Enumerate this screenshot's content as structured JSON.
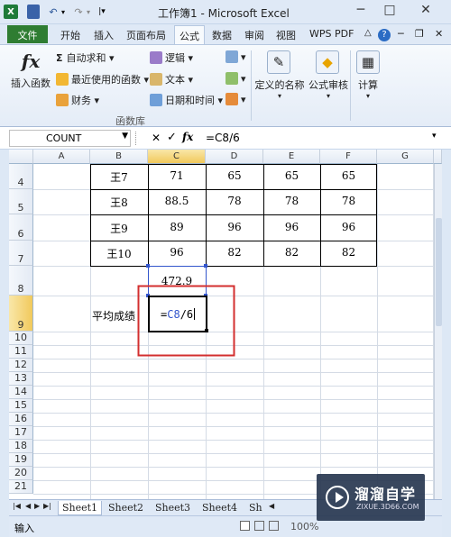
{
  "window": {
    "title": "工作簿1 - Microsoft Excel",
    "minimize_label": "─",
    "maximize_label": "□",
    "close_label": "✕"
  },
  "ribbon_tabs": [
    "文件",
    "开始",
    "插入",
    "页面布局",
    "公式",
    "数据",
    "审阅",
    "视图",
    "WPS PDF"
  ],
  "ribbon": {
    "insert_function": "插入函数",
    "autosum": "自动求和",
    "recent": "最近使用的函数",
    "finance": "财务",
    "logic": "逻辑",
    "text": "文本",
    "datetime": "日期和时间",
    "defined_names": "定义的名称",
    "audit": "公式审核",
    "calc": "计算",
    "group_label": "函数库",
    "fx_symbol": "fx",
    "sigma_symbol": "Σ"
  },
  "formula_bar": {
    "name_box": "COUNT",
    "cancel": "✕",
    "enter": "✓",
    "fx": "fx",
    "formula": "=C8/6"
  },
  "columns": [
    "A",
    "B",
    "C",
    "D",
    "E",
    "F",
    "G"
  ],
  "rows": [
    "4",
    "5",
    "6",
    "7",
    "8",
    "9",
    "10",
    "11",
    "12",
    "13",
    "14",
    "15",
    "16",
    "17",
    "18",
    "19",
    "20",
    "21"
  ],
  "table": [
    [
      "王7",
      "71",
      "65",
      "65",
      "65"
    ],
    [
      "王8",
      "88.5",
      "78",
      "78",
      "78"
    ],
    [
      "王9",
      "89",
      "96",
      "96",
      "96"
    ],
    [
      "王10",
      "96",
      "82",
      "82",
      "82"
    ]
  ],
  "c8_value": "472.9",
  "b9_label": "平均成绩",
  "c9_formula_prefix": "=",
  "c9_formula_ref": "C8",
  "c9_formula_suffix": "/6",
  "sheets": [
    "Sheet1",
    "Sheet2",
    "Sheet3",
    "Sheet4",
    "Sh"
  ],
  "status": {
    "mode": "输入",
    "zoom": "100%"
  },
  "watermark": {
    "brand": "溜溜自学",
    "url": "ZIXUE.3D66.COM"
  },
  "colors": {
    "accent_file_tab": "#2f7d32",
    "highlight_box": "#d32f2f",
    "ref_blue": "#3355cc"
  }
}
